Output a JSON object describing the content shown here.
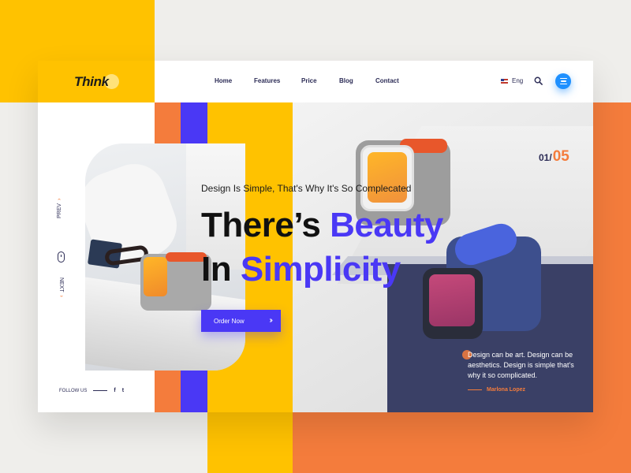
{
  "brand": {
    "name": "Think"
  },
  "nav": {
    "items": [
      "Home",
      "Features",
      "Price",
      "Blog",
      "Contact"
    ]
  },
  "lang": {
    "label": "Eng"
  },
  "slider": {
    "current": "01/",
    "total": "05",
    "prev_label": "PREV",
    "next_label": "NEXT"
  },
  "hero": {
    "tagline": "Design Is Simple, That's Why It's So Complecated",
    "line1_plain": "There’s ",
    "line1_highlight": "Beauty",
    "line2_plain": "In ",
    "line2_highlight": "Simplicity",
    "cta_label": "Order Now"
  },
  "quote": {
    "text": "Design can be art. Design can be aesthetics. Design is simple that's why it so complicated.",
    "author": "Marlona Lopez"
  },
  "social": {
    "follow_label": "FOLLOW US",
    "facebook": "f",
    "twitter": "t"
  },
  "colors": {
    "yellow": "#ffc200",
    "orange": "#f47c3c",
    "blue": "#4a38f5",
    "navy": "#2c2c56",
    "menu_blue": "#1e90ff"
  },
  "icons": [
    "search-icon",
    "menu-icon",
    "flag-icon",
    "mouse-icon",
    "chevron-up-icon",
    "chevron-down-icon",
    "double-chevron-right-icon",
    "facebook-icon",
    "twitter-icon"
  ]
}
